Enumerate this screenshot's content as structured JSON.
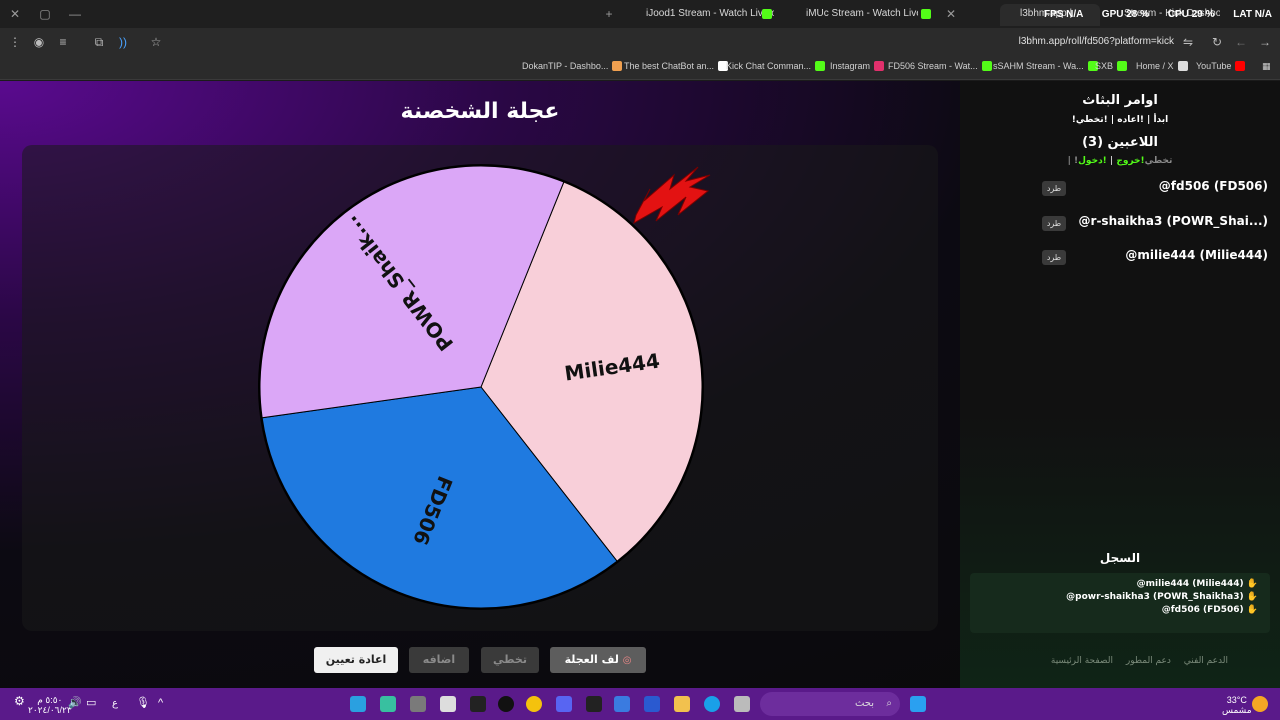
{
  "browser": {
    "tabs": [
      {
        "label": "iJood1 Stream - Watch Live on",
        "active": false
      },
      {
        "label": "iMUc Stream - Watch Live on K",
        "active": false
      },
      {
        "label": "l3bhm.app | ",
        "active": true
      },
      {
        "label": "Stream - Kick Dashboard",
        "active": false
      }
    ],
    "stats": {
      "fps": "FPS N/A",
      "gpu": "GPU 28 %",
      "cpu": "CPU 29 %",
      "lat": "LAT N/A"
    },
    "url": "l3bhm.app/roll/fd506?platform=kick",
    "bookmarks": [
      {
        "label": "DokanTIP - Dashbo...",
        "color": "#f0a050"
      },
      {
        "label": "The best ChatBot an...",
        "color": "#ffffff"
      },
      {
        "label": "Kick Chat Comman...",
        "color": "#53fc18"
      },
      {
        "label": "Instagram",
        "color": "#e1306c"
      },
      {
        "label": "FD506 Stream - Wat...",
        "color": "#53fc18"
      },
      {
        "label": "sSAHM Stream - Wa...",
        "color": "#53fc18"
      },
      {
        "label": "SXB",
        "color": "#53fc18"
      },
      {
        "label": "Home / X",
        "color": "#ffffff"
      },
      {
        "label": "YouTube",
        "color": "#ff0000"
      }
    ]
  },
  "main": {
    "title": "عجلة الشخصنة",
    "buttons": {
      "reset": "اعادة تعيين",
      "add": "اضافه",
      "skip": "تخطي",
      "spin": "لف العجلة"
    }
  },
  "chart_data": {
    "type": "pie",
    "slices": [
      {
        "label": "Milie444",
        "value": 1,
        "color": "#f8cfd9"
      },
      {
        "label": "FD506",
        "value": 1,
        "color": "#1f7ae0"
      },
      {
        "label": "POWR_Shaik...",
        "value": 1,
        "color": "#dba7f7"
      }
    ],
    "pointer_color": "#e31212"
  },
  "sidebar": {
    "commands_title": "اوامر البثاث",
    "commands": "!ابدأ | !اعاده | !تخطي",
    "players_title": "اللاعبين (3)",
    "join_leave": {
      "join": "!دخول",
      "sep": " | ",
      "leave": "!خروج",
      "skip": " | !تخطي"
    },
    "kick_label": "طرد",
    "players": [
      {
        "name": "@fd506 (FD506)"
      },
      {
        "name": "@r-shaikha3 (POWR_Shai...)"
      },
      {
        "name": "@milie444 (Milie444)"
      }
    ],
    "log_title": "السجل",
    "log": [
      "@milie444 (Milie444)",
      "@powr-shaikha3 (POWR_Shaikha3)",
      "@fd506 (FD506)"
    ],
    "footer": [
      "الصفحة الرئيسية",
      "دعم المطور",
      "الدعم الفني"
    ]
  },
  "taskbar": {
    "search_placeholder": "بحث",
    "weather": "33°C",
    "weather_desc": "مشمس",
    "lang": "ع",
    "time": "٥:٥٠ م",
    "date": "٢٠٢٤/٠٦/٢٣"
  }
}
